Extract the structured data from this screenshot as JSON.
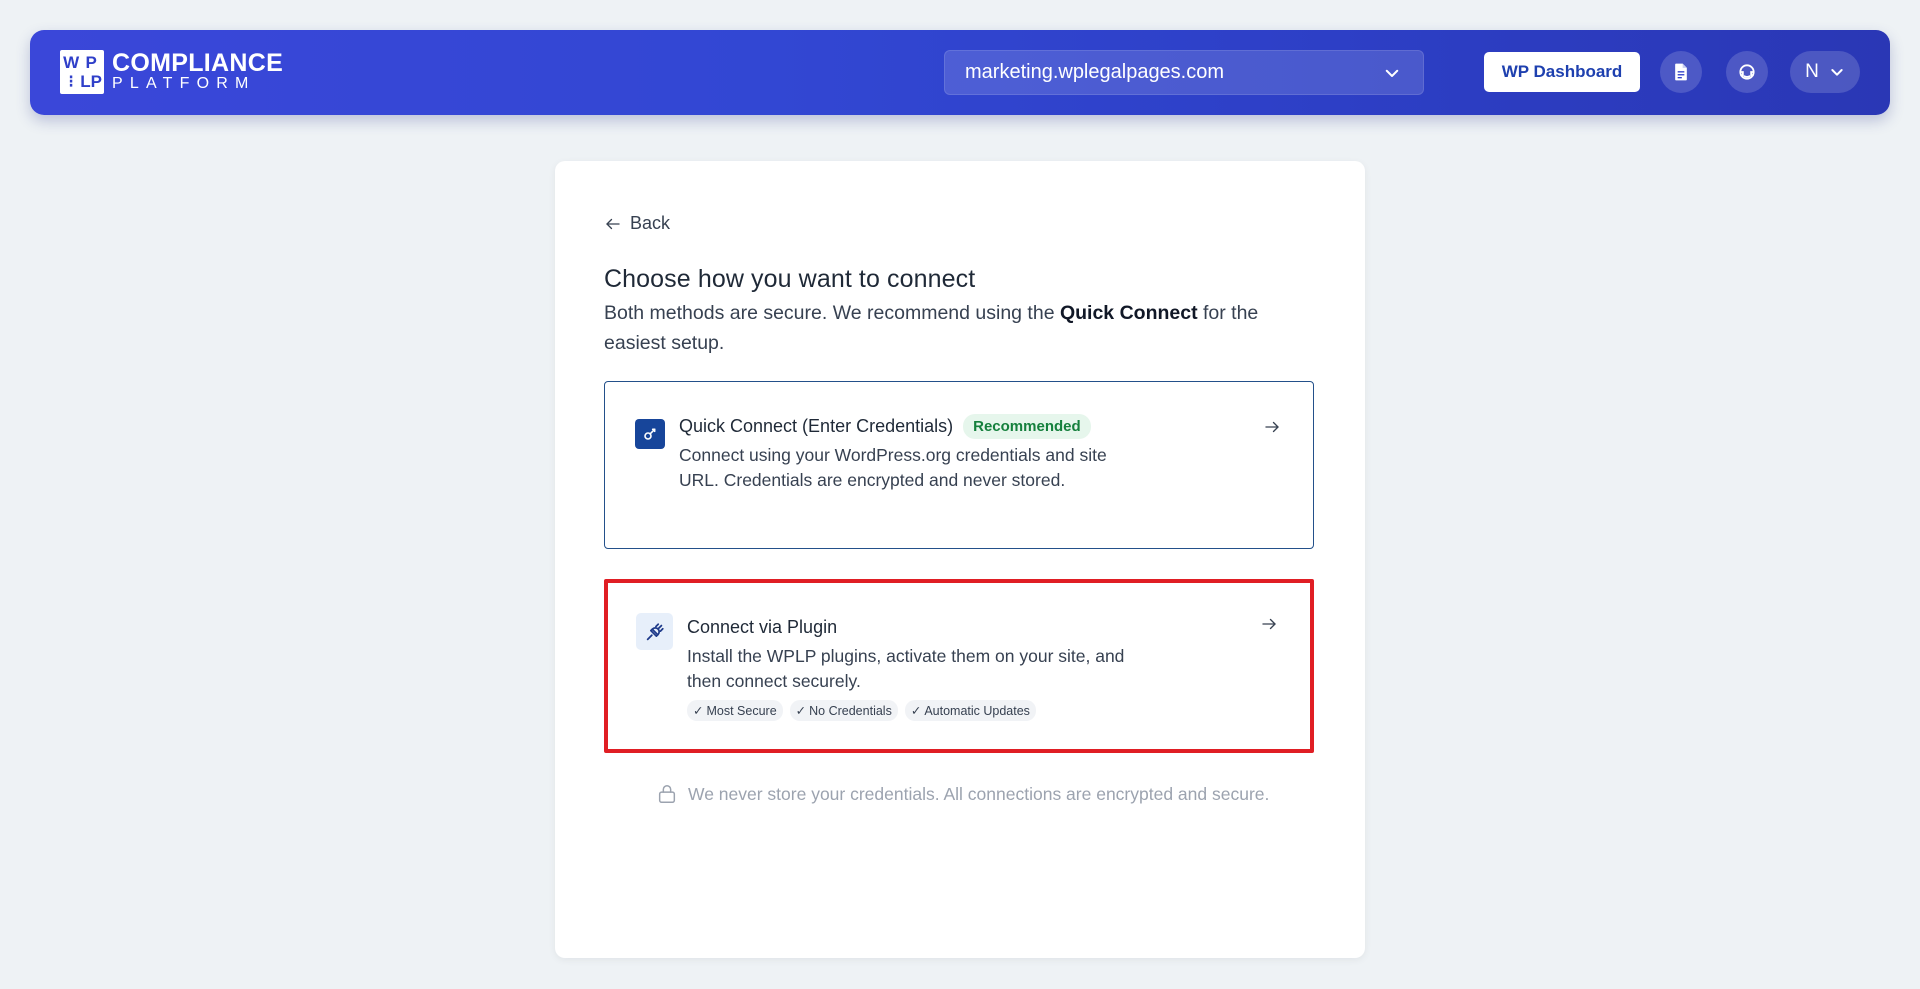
{
  "header": {
    "logo": {
      "mark_letters": [
        "WP",
        "",
        "LP",
        ""
      ],
      "line1": "COMPLIANCE",
      "line2": "PLATFORM"
    },
    "site_selector": {
      "value": "marketing.wplegalpages.com",
      "icon": "chevron-down-icon"
    },
    "wp_dashboard_label": "WP Dashboard",
    "icons": [
      "document-icon",
      "support-icon"
    ],
    "user": {
      "initial": "N",
      "icon": "chevron-down-icon"
    },
    "colors": {
      "gradient_start": "#3a47d9",
      "gradient_end": "#2a37b5"
    }
  },
  "card": {
    "back_label": "Back",
    "heading": "Choose how you want to connect",
    "subtext_before": "Both methods are secure. We recommend using the ",
    "subtext_bold": "Quick Connect",
    "subtext_after": " for the easiest setup.",
    "options": [
      {
        "title": "Quick Connect (Enter Credentials)",
        "badge": "Recommended",
        "description": "Connect using your WordPress.org credentials and site URL. Credentials are encrypted and never stored.",
        "icon": "key-icon"
      },
      {
        "title": "Connect via Plugin",
        "description": "Install the WPLP plugins, activate them on your site, and then connect securely.",
        "tags": [
          "Most Secure",
          "No Credentials",
          "Automatic Updates"
        ],
        "icon": "plug-icon",
        "highlight_color": "#e01e24"
      }
    ],
    "security_note": "We never store your credentials. All connections are encrypted and secure."
  }
}
